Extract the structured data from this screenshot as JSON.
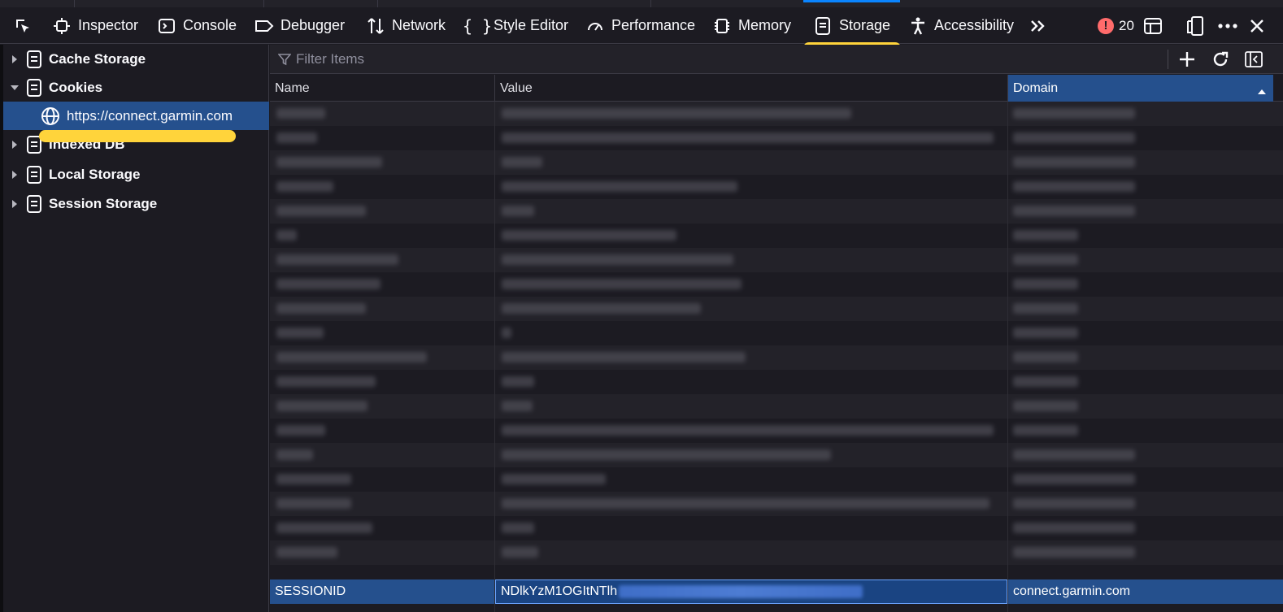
{
  "toolbar": {
    "tabs": [
      {
        "label": "Inspector",
        "icon": "inspector-icon"
      },
      {
        "label": "Console",
        "icon": "console-icon"
      },
      {
        "label": "Debugger",
        "icon": "debugger-icon"
      },
      {
        "label": "Network",
        "icon": "network-icon"
      },
      {
        "label": "Style Editor",
        "icon": "style-editor-icon"
      },
      {
        "label": "Performance",
        "icon": "performance-icon"
      },
      {
        "label": "Memory",
        "icon": "memory-icon"
      },
      {
        "label": "Storage",
        "icon": "storage-icon",
        "active": true
      },
      {
        "label": "Accessibility",
        "icon": "accessibility-icon"
      }
    ],
    "error_count": "20",
    "active_tab_color": "#0a84ff"
  },
  "sidebar": {
    "items": [
      {
        "label": "Cache Storage",
        "expanded": false
      },
      {
        "label": "Cookies",
        "expanded": true
      },
      {
        "label": "https://connect.garmin.com",
        "child": true,
        "selected": true
      },
      {
        "label": "Indexed DB",
        "expanded": false
      },
      {
        "label": "Local Storage",
        "expanded": false
      },
      {
        "label": "Session Storage",
        "expanded": false
      }
    ]
  },
  "filter": {
    "placeholder": "Filter Items"
  },
  "table": {
    "columns": [
      "Name",
      "Value",
      "Domain"
    ],
    "sorted_column": "Domain",
    "selected_row": {
      "name": "SESSIONID",
      "value": "NDlkYzM1OGItNTlh",
      "domain": "connect.garmin.com"
    },
    "visible_domain_rows": [
      "connect.garmin.com",
      "connect.garmin.com",
      "connect.garmin.com",
      "connect.garmin.com",
      "connect.garmin.com"
    ]
  },
  "colors": {
    "selection": "#25508d",
    "highlight_marker": "#ffd43b",
    "error": "#ff6b6b"
  }
}
